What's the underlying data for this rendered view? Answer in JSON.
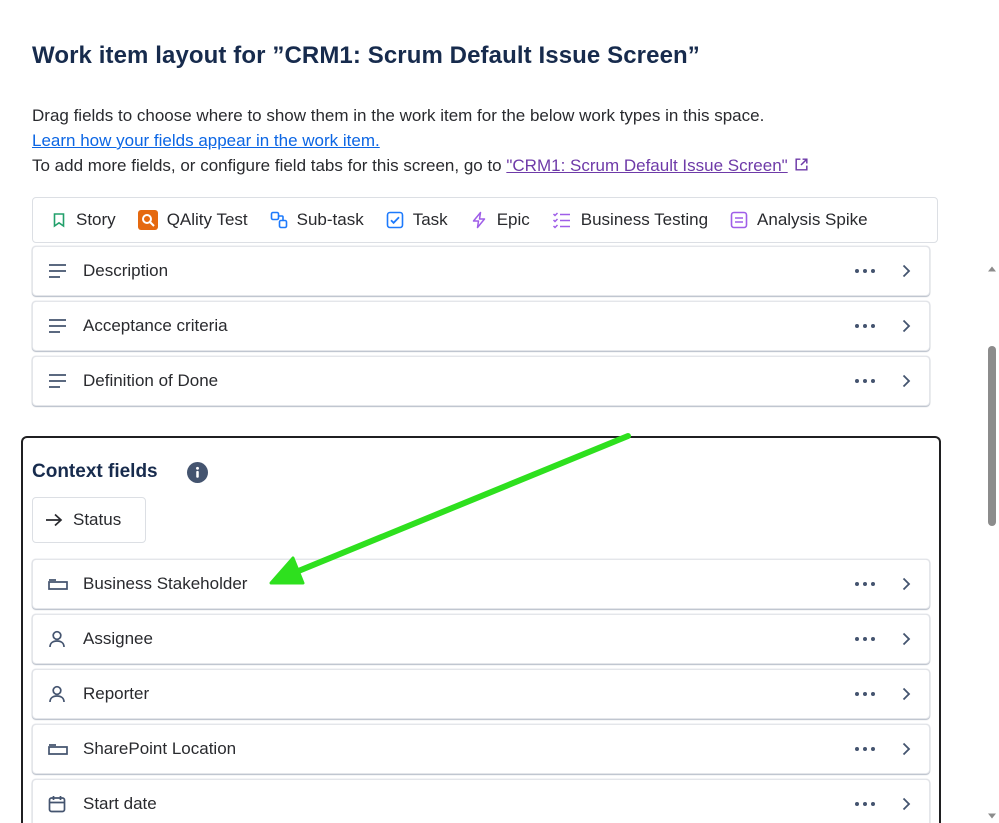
{
  "page": {
    "title": "Work item layout for ”CRM1: Scrum Default Issue Screen”",
    "description_line1": "Drag fields to choose where to show them in the work item for the below work types in this space.",
    "learn_link": "Learn how your fields appear in the work item.",
    "description_line3_prefix": "To add more fields, or configure field tabs for this screen, go to ",
    "screen_link": "\"CRM1: Scrum Default Issue Screen\""
  },
  "work_types": [
    {
      "label": "Story",
      "icon": "story-icon",
      "color": "#22a06b"
    },
    {
      "label": "QAlity Test",
      "icon": "qality-test-icon",
      "color": "#e56910"
    },
    {
      "label": "Sub-task",
      "icon": "subtask-icon",
      "color": "#1d7afc"
    },
    {
      "label": "Task",
      "icon": "task-icon",
      "color": "#1d7afc"
    },
    {
      "label": "Epic",
      "icon": "epic-icon",
      "color": "#9f5ee8"
    },
    {
      "label": "Business Testing",
      "icon": "checklist-icon",
      "color": "#9f5ee8"
    },
    {
      "label": "Analysis Spike",
      "icon": "page-icon",
      "color": "#9f5ee8"
    }
  ],
  "description_fields": [
    {
      "label": "Description",
      "icon": "text-lines-icon"
    },
    {
      "label": "Acceptance criteria",
      "icon": "text-lines-icon"
    },
    {
      "label": "Definition of Done",
      "icon": "text-lines-icon"
    }
  ],
  "context": {
    "title": "Context fields",
    "status_label": "Status",
    "fields": [
      {
        "label": "Business Stakeholder",
        "icon": "folder-field-icon"
      },
      {
        "label": "Assignee",
        "icon": "person-icon"
      },
      {
        "label": "Reporter",
        "icon": "person-icon"
      },
      {
        "label": "SharePoint Location",
        "icon": "folder-field-icon"
      },
      {
        "label": "Start date",
        "icon": "calendar-icon"
      }
    ]
  },
  "annotation": {
    "color": "#2ee01e"
  }
}
